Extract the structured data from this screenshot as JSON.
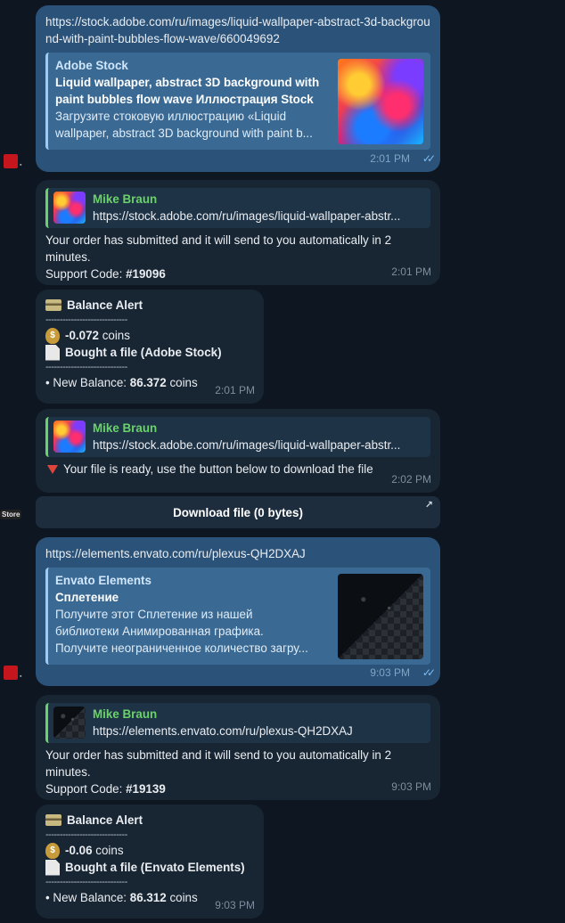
{
  "colors": {
    "outgoing_bubble": "#2b5278",
    "incoming_bubble": "#182533",
    "reply_name": "#6ad26a",
    "background": "#0e1621"
  },
  "messages": {
    "m1": {
      "link": "https://stock.adobe.com/ru/images/liquid-wallpaper-abstract-3d-background-with-paint-bubbles-flow-wave/660049692",
      "preview_site": "Adobe Stock",
      "preview_title": "Liquid wallpaper, abstract 3D background with paint bubbles flow wave Иллюстрация Stock",
      "preview_desc_1": "Загрузите стоковую иллюстрацию «Liquid",
      "preview_desc_2": "wallpaper, abstract 3D background with paint b...",
      "time": "2:01 PM"
    },
    "m2": {
      "reply_name": "Mike Braun",
      "reply_text": "https://stock.adobe.com/ru/images/liquid-wallpaper-abstr...",
      "body_1": "Your order has submitted and it will send to you automatically in 2",
      "body_2": "minutes.",
      "support_label": "Support Code: ",
      "support_code": "#19096",
      "time": "2:01 PM"
    },
    "m3": {
      "title": "Balance Alert",
      "separator": "-----------------------------",
      "amount": "-0.072",
      "amount_unit": " coins",
      "bought": "Bought a file (Adobe Stock)",
      "balance_label": "• New Balance: ",
      "balance_value": "86.372",
      "balance_unit": " coins",
      "time": "2:01 PM"
    },
    "m4": {
      "reply_name": "Mike Braun",
      "reply_text": "https://stock.adobe.com/ru/images/liquid-wallpaper-abstr...",
      "body": "Your file is ready, use the button below to download the file",
      "time": "2:02 PM",
      "button_label": "Download file (0 bytes)"
    },
    "m5": {
      "link": "https://elements.envato.com/ru/plexus-QH2DXAJ",
      "preview_site": "Envato Elements",
      "preview_title": "Сплетение",
      "preview_desc_1": "Получите этот Сплетение из нашей",
      "preview_desc_2": "библиотеки Анимированная графика.",
      "preview_desc_3": "Получите неограниченное количество загру...",
      "time": "9:03 PM"
    },
    "m6": {
      "reply_name": "Mike Braun",
      "reply_text": "https://elements.envato.com/ru/plexus-QH2DXAJ",
      "body_1": "Your order has submitted and it will send to you automatically in 2",
      "body_2": "minutes.",
      "support_label": "Support Code: ",
      "support_code": "#19139",
      "time": "9:03 PM"
    },
    "m7": {
      "title": "Balance Alert",
      "separator": "-----------------------------",
      "amount": "-0.06",
      "amount_unit": " coins",
      "bought": "Bought a file (Envato Elements)",
      "balance_label": "• New Balance: ",
      "balance_value": "86.312",
      "balance_unit": " coins",
      "time": "9:03 PM"
    }
  }
}
